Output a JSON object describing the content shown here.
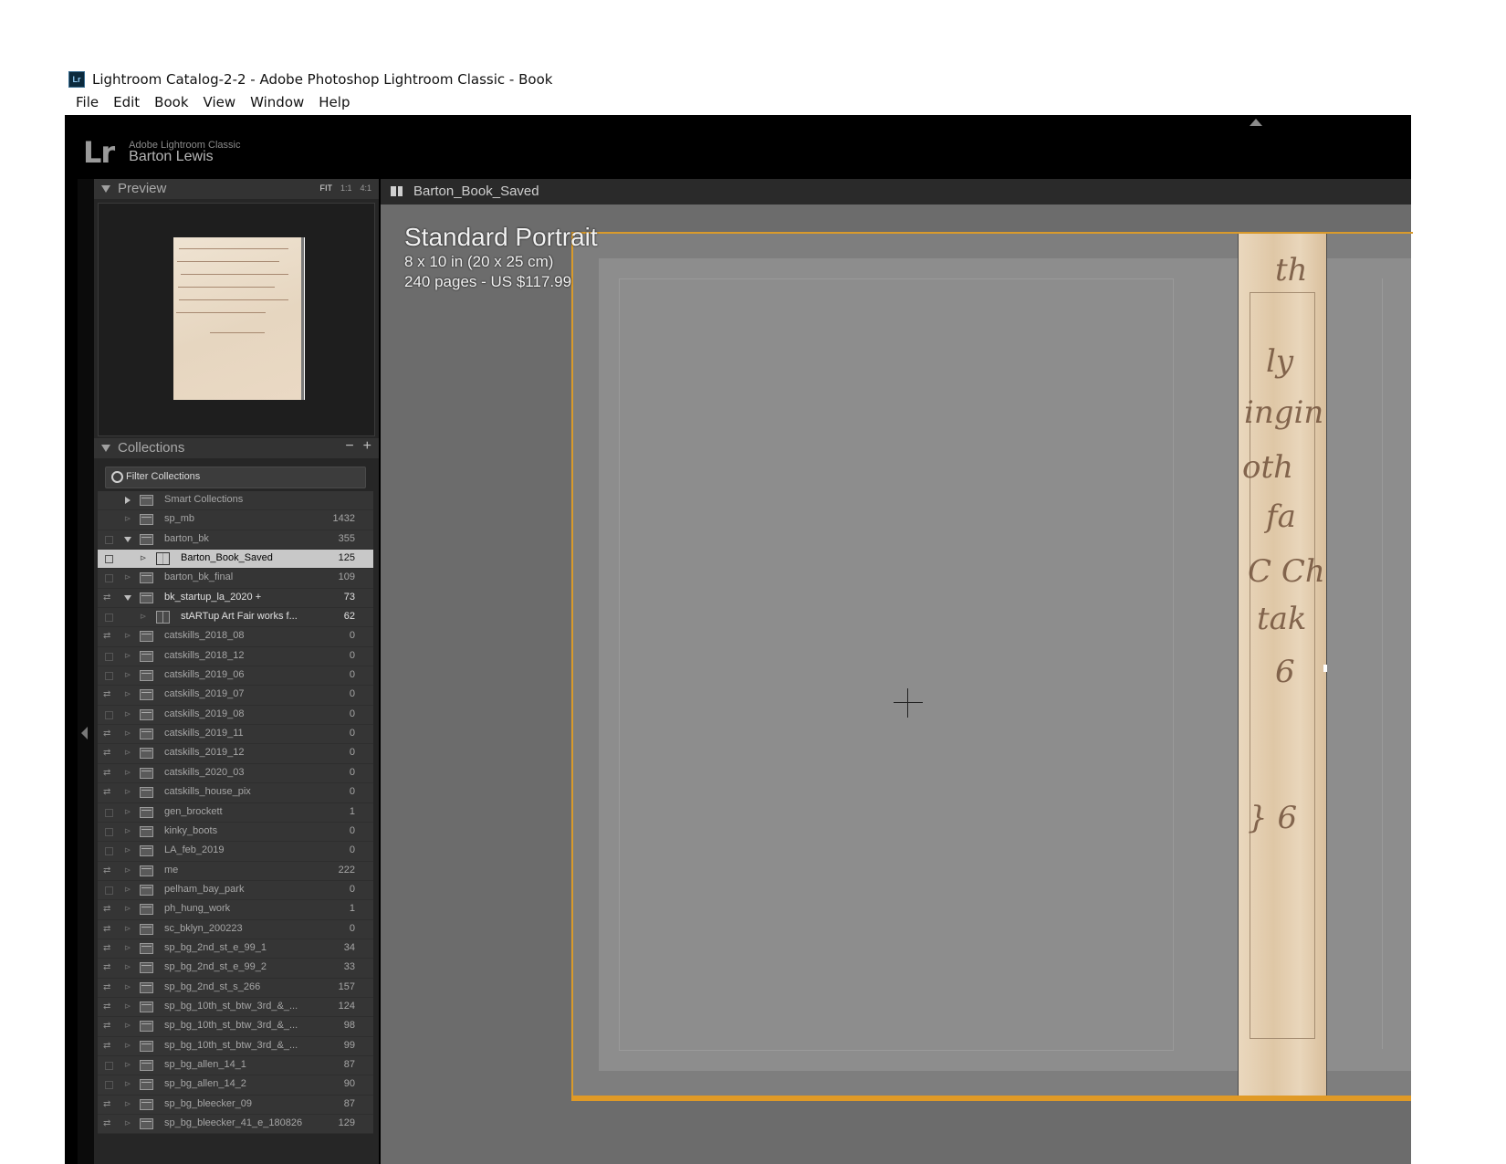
{
  "window": {
    "title": "Lightroom Catalog-2-2 - Adobe Photoshop Lightroom Classic - Book",
    "icon": "Lr"
  },
  "menu": [
    "File",
    "Edit",
    "Book",
    "View",
    "Window",
    "Help"
  ],
  "identity": {
    "logo": "Lr",
    "product": "Adobe Lightroom Classic",
    "user": "Barton Lewis"
  },
  "preview_panel": {
    "title": "Preview",
    "zoom": [
      "FIT",
      "1:1",
      "4:1"
    ]
  },
  "collections_panel": {
    "title": "Collections",
    "remove_symbol": "−",
    "add_symbol": "+",
    "filter_placeholder": "Filter Collections",
    "items": [
      {
        "label": "Smart Collections",
        "count": ""
      },
      {
        "label": "sp_mb",
        "count": "1432"
      },
      {
        "label": "barton_bk",
        "count": "355"
      },
      {
        "label": "Barton_Book_Saved",
        "count": "125"
      },
      {
        "label": "barton_bk_final",
        "count": "109"
      },
      {
        "label": "bk_startup_la_2020  +",
        "count": "73"
      },
      {
        "label": "stARTup Art Fair works f...",
        "count": "62"
      },
      {
        "label": "catskills_2018_08",
        "count": "0"
      },
      {
        "label": "catskills_2018_12",
        "count": "0"
      },
      {
        "label": "catskills_2019_06",
        "count": "0"
      },
      {
        "label": "catskills_2019_07",
        "count": "0"
      },
      {
        "label": "catskills_2019_08",
        "count": "0"
      },
      {
        "label": "catskills_2019_11",
        "count": "0"
      },
      {
        "label": "catskills_2019_12",
        "count": "0"
      },
      {
        "label": "catskills_2020_03",
        "count": "0"
      },
      {
        "label": "catskills_house_pix",
        "count": "0"
      },
      {
        "label": "gen_brockett",
        "count": "1"
      },
      {
        "label": "kinky_boots",
        "count": "0"
      },
      {
        "label": "LA_feb_2019",
        "count": "0"
      },
      {
        "label": "me",
        "count": "222"
      },
      {
        "label": "pelham_bay_park",
        "count": "0"
      },
      {
        "label": "ph_hung_work",
        "count": "1"
      },
      {
        "label": "sc_bklyn_200223",
        "count": "0"
      },
      {
        "label": "sp_bg_2nd_st_e_99_1",
        "count": "34"
      },
      {
        "label": "sp_bg_2nd_st_e_99_2",
        "count": "33"
      },
      {
        "label": "sp_bg_2nd_st_s_266",
        "count": "157"
      },
      {
        "label": "sp_bg_10th_st_btw_3rd_&_...",
        "count": "124"
      },
      {
        "label": "sp_bg_10th_st_btw_3rd_&_...",
        "count": "98"
      },
      {
        "label": "sp_bg_10th_st_btw_3rd_&_...",
        "count": "99"
      },
      {
        "label": "sp_bg_allen_14_1",
        "count": "87"
      },
      {
        "label": "sp_bg_allen_14_2",
        "count": "90"
      },
      {
        "label": "sp_bg_bleecker_09",
        "count": "87"
      },
      {
        "label": "sp_bg_bleecker_41_e_180826",
        "count": "129"
      }
    ]
  },
  "center": {
    "title": "Barton_Book_Saved",
    "book_style": "Standard Portrait",
    "book_size": "8 x 10 in (20 x 25 cm)",
    "book_pages": "240 pages - US $117.99"
  },
  "colors": {
    "accent_outline": "#d99a2b",
    "panel_bg": "#262626",
    "selected_row": "#c8c8c8"
  }
}
